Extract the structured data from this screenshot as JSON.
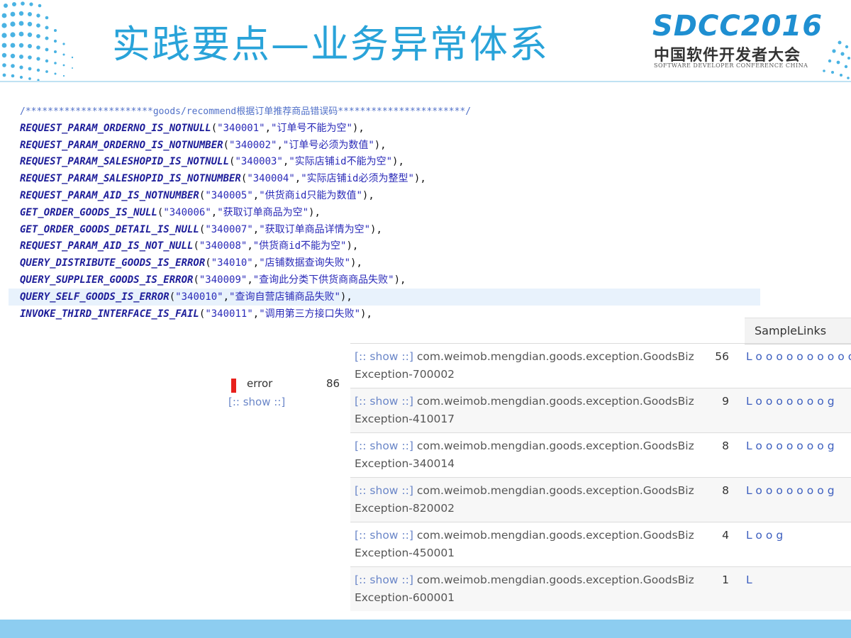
{
  "slide": {
    "title": "实践要点—业务异常体系",
    "logo_main": "SDCC",
    "logo_year": "2016",
    "logo_cn": "中国软件开发者大会",
    "logo_en": "SOFTWARE DEVELOPER CONFERENCE CHINA"
  },
  "code": {
    "comment": "/***********************goods/recommend根据订单推荐商品错误码***********************/",
    "lines": [
      {
        "const": "REQUEST_PARAM_ORDERNO_IS_NOTNULL",
        "code": "\"340001\"",
        "msg": "\"订单号不能为空\""
      },
      {
        "const": "REQUEST_PARAM_ORDERNO_IS_NOTNUMBER",
        "code": "\"340002\"",
        "msg": "\"订单号必须为数值\""
      },
      {
        "const": "REQUEST_PARAM_SALESHOPID_IS_NOTNULL",
        "code": "\"340003\"",
        "msg": "\"实际店铺id不能为空\""
      },
      {
        "const": "REQUEST_PARAM_SALESHOPID_IS_NOTNUMBER",
        "code": "\"340004\"",
        "msg": "\"实际店铺id必须为整型\""
      },
      {
        "const": "REQUEST_PARAM_AID_IS_NOTNUMBER",
        "code": "\"340005\"",
        "msg": "\"供货商id只能为数值\""
      },
      {
        "const": "GET_ORDER_GOODS_IS_NULL",
        "code": "\"340006\"",
        "msg": "\"获取订单商品为空\""
      },
      {
        "const": "GET_ORDER_GOODS_DETAIL_IS_NULL",
        "code": "\"340007\"",
        "msg": "\"获取订单商品详情为空\""
      },
      {
        "const": "REQUEST_PARAM_AID_IS_NOT_NULL",
        "code": "\"340008\"",
        "msg": "\"供货商id不能为空\""
      },
      {
        "const": "QUERY_DISTRIBUTE_GOODS_IS_ERROR",
        "code": "\"34010\"",
        "msg": "\"店铺数据查询失败\""
      },
      {
        "const": "QUERY_SUPPLIER_GOODS_IS_ERROR",
        "code": "\"340009\"",
        "msg": "\"查询此分类下供货商商品失败\""
      },
      {
        "const": "QUERY_SELF_GOODS_IS_ERROR",
        "code": "\"340010\"",
        "msg": "\"查询自营店铺商品失败\""
      },
      {
        "const": "INVOKE_THIRD_INTERFACE_IS_FAIL",
        "code": "\"340011\"",
        "msg": "\"调用第三方接口失败\""
      }
    ]
  },
  "table": {
    "header_samples": "SampleLinks",
    "level": "error",
    "level_show": "[:: show ::]",
    "level_count": "86",
    "rows": [
      {
        "show": "[:: show ::]",
        "exception": "com.weimob.mengdian.goods.exception.GoodsBizException-700002",
        "count": "56",
        "spark": "Looooooooooooo"
      },
      {
        "show": "[:: show ::]",
        "exception": "com.weimob.mengdian.goods.exception.GoodsBizException-410017",
        "count": "9",
        "spark": "Looooooog"
      },
      {
        "show": "[:: show ::]",
        "exception": "com.weimob.mengdian.goods.exception.GoodsBizException-340014",
        "count": "8",
        "spark": "Looooooog"
      },
      {
        "show": "[:: show ::]",
        "exception": "com.weimob.mengdian.goods.exception.GoodsBizException-820002",
        "count": "8",
        "spark": "Looooooog"
      },
      {
        "show": "[:: show ::]",
        "exception": "com.weimob.mengdian.goods.exception.GoodsBizException-450001",
        "count": "4",
        "spark": "Loog"
      },
      {
        "show": "[:: show ::]",
        "exception": "com.weimob.mengdian.goods.exception.GoodsBizException-600001",
        "count": "1",
        "spark": "L"
      }
    ]
  }
}
